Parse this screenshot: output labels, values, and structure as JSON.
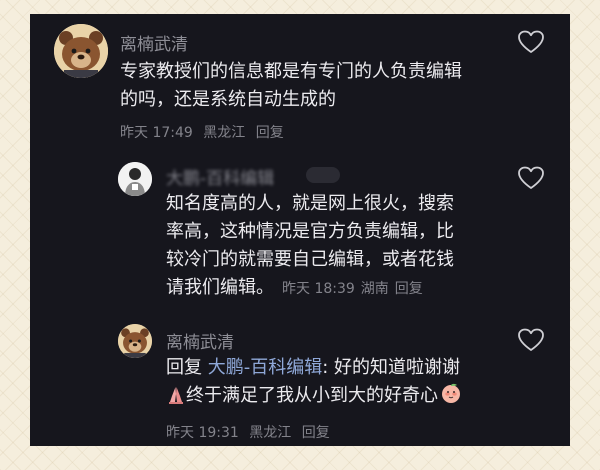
{
  "comments": [
    {
      "username": "离楠武清",
      "lines": [
        "专家教授们的信息都是有专门的人负责编辑",
        "的吗，还是系统自动生成的"
      ],
      "time": "昨天 17:49",
      "location": "黑龙江",
      "reply_label": "回复"
    },
    {
      "username": "大鹏-百科编辑",
      "lines": [
        "知名度高的人，就是网上很火，搜索",
        "率高，这种情况是官方负责编辑，比",
        "较冷门的就需要自己编辑，或者花钱",
        "请我们编辑。"
      ],
      "time": "昨天 18:39",
      "location": "湖南",
      "reply_label": "回复"
    },
    {
      "username": "离楠武清",
      "reply_prefix": "回复",
      "reply_to": "大鹏-百科编辑",
      "line1_rest": ": 好的知道啦谢谢",
      "line2": "终于满足了我从小到大的好奇心",
      "time": "昨天 19:31",
      "location": "黑龙江",
      "reply_label": "回复"
    }
  ],
  "colors": {
    "background": "#16161d",
    "text": "#ecebef",
    "secondary": "#83838b",
    "mention": "#8fa8d8"
  }
}
